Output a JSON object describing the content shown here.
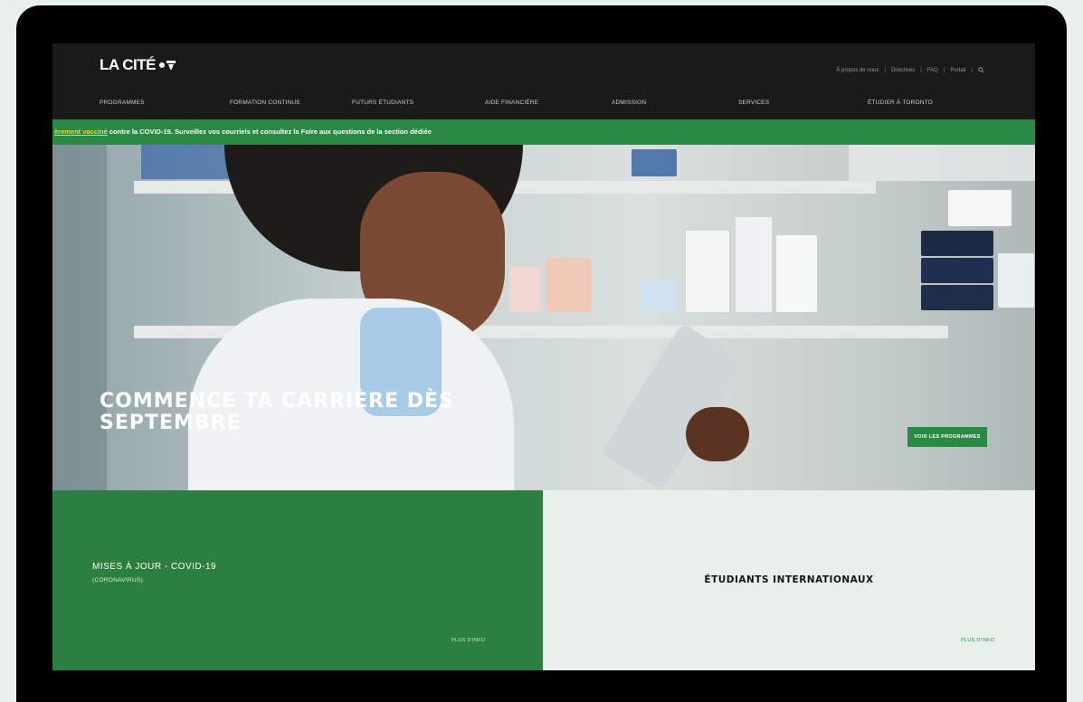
{
  "header": {
    "logo_text": "LA CITÉ",
    "utility_links": [
      "À propos de nous",
      "Directives",
      "FAQ",
      "Portail"
    ],
    "utility_separator": "|"
  },
  "nav": {
    "items": [
      "PROGRAMMES",
      "FORMATION CONTINUE",
      "FUTURS ÉTUDIANTS",
      "AIDE FINANCIÈRE",
      "ADMISSION",
      "SERVICES",
      "ÉTUDIER À TORONTO"
    ]
  },
  "banner": {
    "link_text": "èrement vacciné",
    "text": " contre la COVID-19. Surveillez vos courriels et consultez la Foire aux questions de la section dédiée"
  },
  "hero": {
    "title_line1": "COMMENCE TA CARRIÈRE DÈS",
    "title_line2": "SEPTEMBRE",
    "button_label": "VOIR LES PROGRAMMES"
  },
  "tiles": {
    "left": {
      "title": "MISES À JOUR - COVID-19",
      "subtitle": "(CORONAVIRUS)",
      "more": "PLUS D'INFO"
    },
    "right": {
      "title": "ÉTUDIANTS INTERNATIONAUX",
      "more": "PLUS D'INFO"
    }
  },
  "colors": {
    "brand_green": "#2a8a45",
    "header_bg": "#1a1a1a",
    "banner_link": "#f2d24a"
  },
  "icons": {
    "search": "search-icon"
  }
}
